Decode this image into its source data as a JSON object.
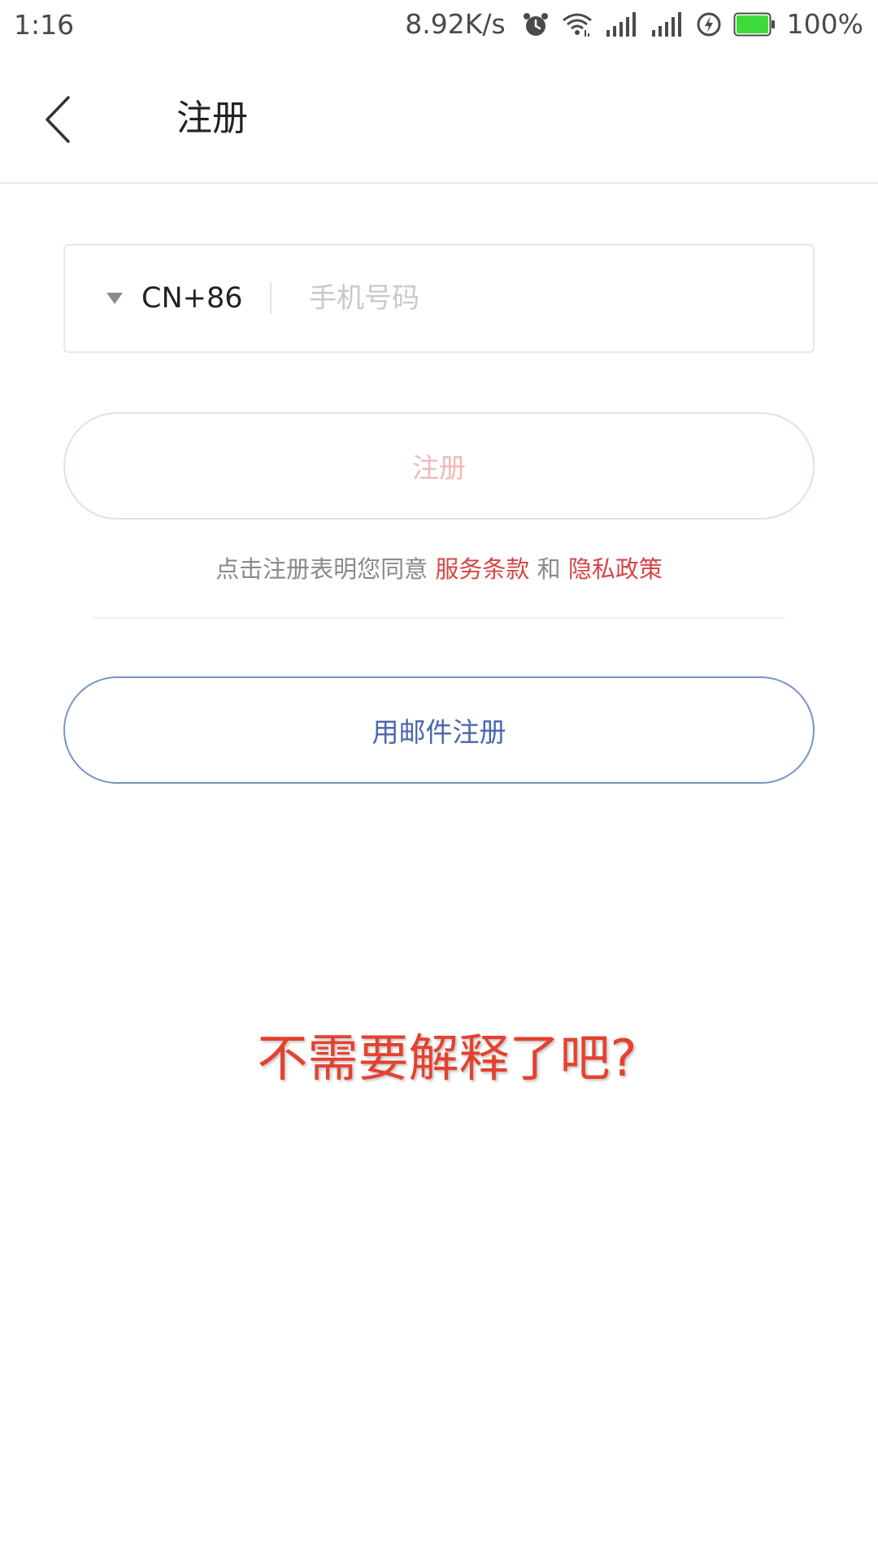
{
  "status_bar": {
    "time": "1:16",
    "net_speed": "8.92K/s",
    "battery_percent": "100%",
    "icons": [
      "alarm-icon",
      "wifi-icon",
      "signal-icon",
      "signal-icon",
      "charging-icon",
      "battery-icon"
    ],
    "battery_color": "#3ddc3a"
  },
  "app_bar": {
    "back_icon": "chevron-left-icon",
    "title": "注册"
  },
  "phone_form": {
    "country_code": "CN+86",
    "phone_placeholder": "手机号码",
    "phone_value": ""
  },
  "register_button": {
    "label": "注册",
    "enabled": false
  },
  "agreement": {
    "prefix": "点击注册表明您同意",
    "terms_link": "服务条款",
    "conjunction": "和",
    "privacy_link": "隐私政策"
  },
  "email_register_button": {
    "label": "用邮件注册"
  },
  "caption": "不需要解释了吧?",
  "colors": {
    "link_red": "#d64545",
    "email_blue": "#4868ad",
    "caption_red": "#e5412f"
  }
}
